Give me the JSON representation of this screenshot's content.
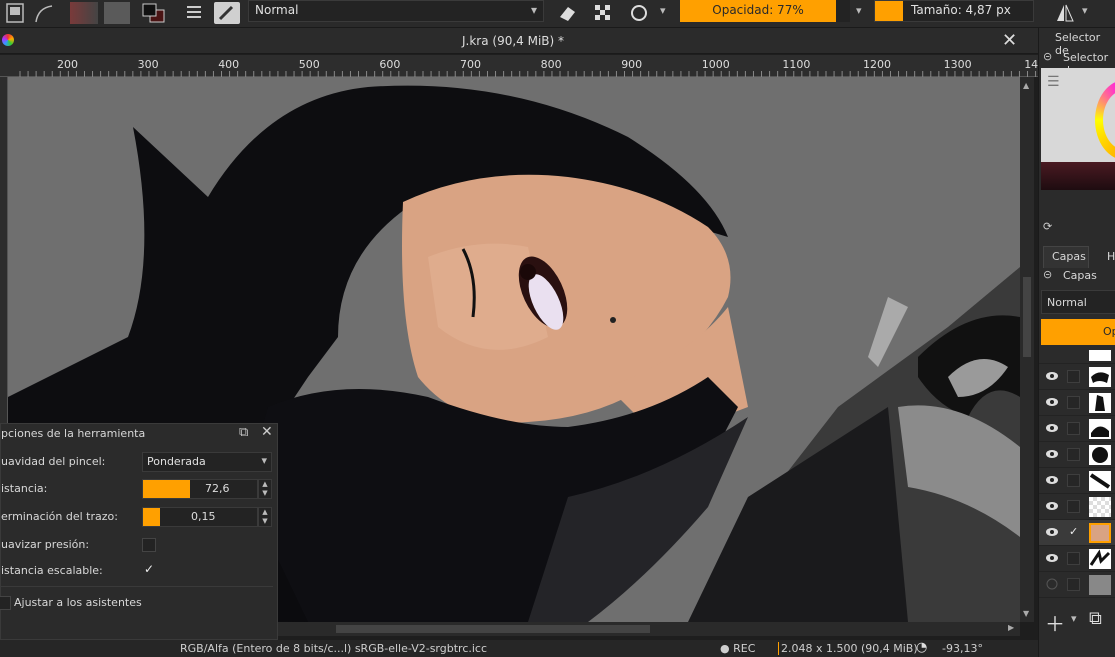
{
  "toolbar": {
    "blend_mode": "Normal",
    "opacity": "Opacidad: 77%",
    "size": "Tamaño: 4,87 px",
    "accent": "#ffa000",
    "icons": [
      "brush-preset-icon",
      "gradient-icon",
      "pattern-icon",
      "fg-bg-color-icon",
      "menu-lines-icon",
      "brush-editor-icon",
      "eraser-icon",
      "alpha-lock-icon",
      "reload-icon",
      "mirror-icon"
    ]
  },
  "document": {
    "title": "J.kra (90,4 MiB) *"
  },
  "ruler": {
    "ticks": [
      "200",
      "300",
      "400",
      "500",
      "600",
      "700",
      "800",
      "900",
      "1000",
      "1100",
      "1200",
      "1300",
      "14"
    ]
  },
  "tool_options": {
    "header": "pciones de la herramienta",
    "smoothing_label": "uavidad del pincel:",
    "smoothing_value": "Ponderada",
    "distance_label": "istancia:",
    "distance_value": "72,6",
    "distance_fill": 0.55,
    "stroke_end_label": "erminación del trazo:",
    "stroke_end_value": "0,15",
    "stroke_end_fill": 0.15,
    "smooth_pressure_label": "uavizar presión:",
    "scalable_distance_label": "istancia escalable:",
    "scalable_distance_checked": "✓",
    "snap_label": "Ajustar a los asistentes"
  },
  "docker": {
    "color_selector_title": "Selector de",
    "color_selector_tab": "Selector d",
    "layers_tab": "Capas",
    "second_tab": "H",
    "layers_title": "Capas",
    "blend_mode": "Normal",
    "opacity_label": "Op",
    "active_layer_check": "✓"
  },
  "status": {
    "color_space": "RGB/Alfa (Entero de 8 bits/c...l)  sRGB-elle-V2-srgbtrc.icc",
    "rec": "● REC",
    "dimensions": "2.048 x 1.500 (90,4 MiB)",
    "rotation": "-93,13°"
  }
}
